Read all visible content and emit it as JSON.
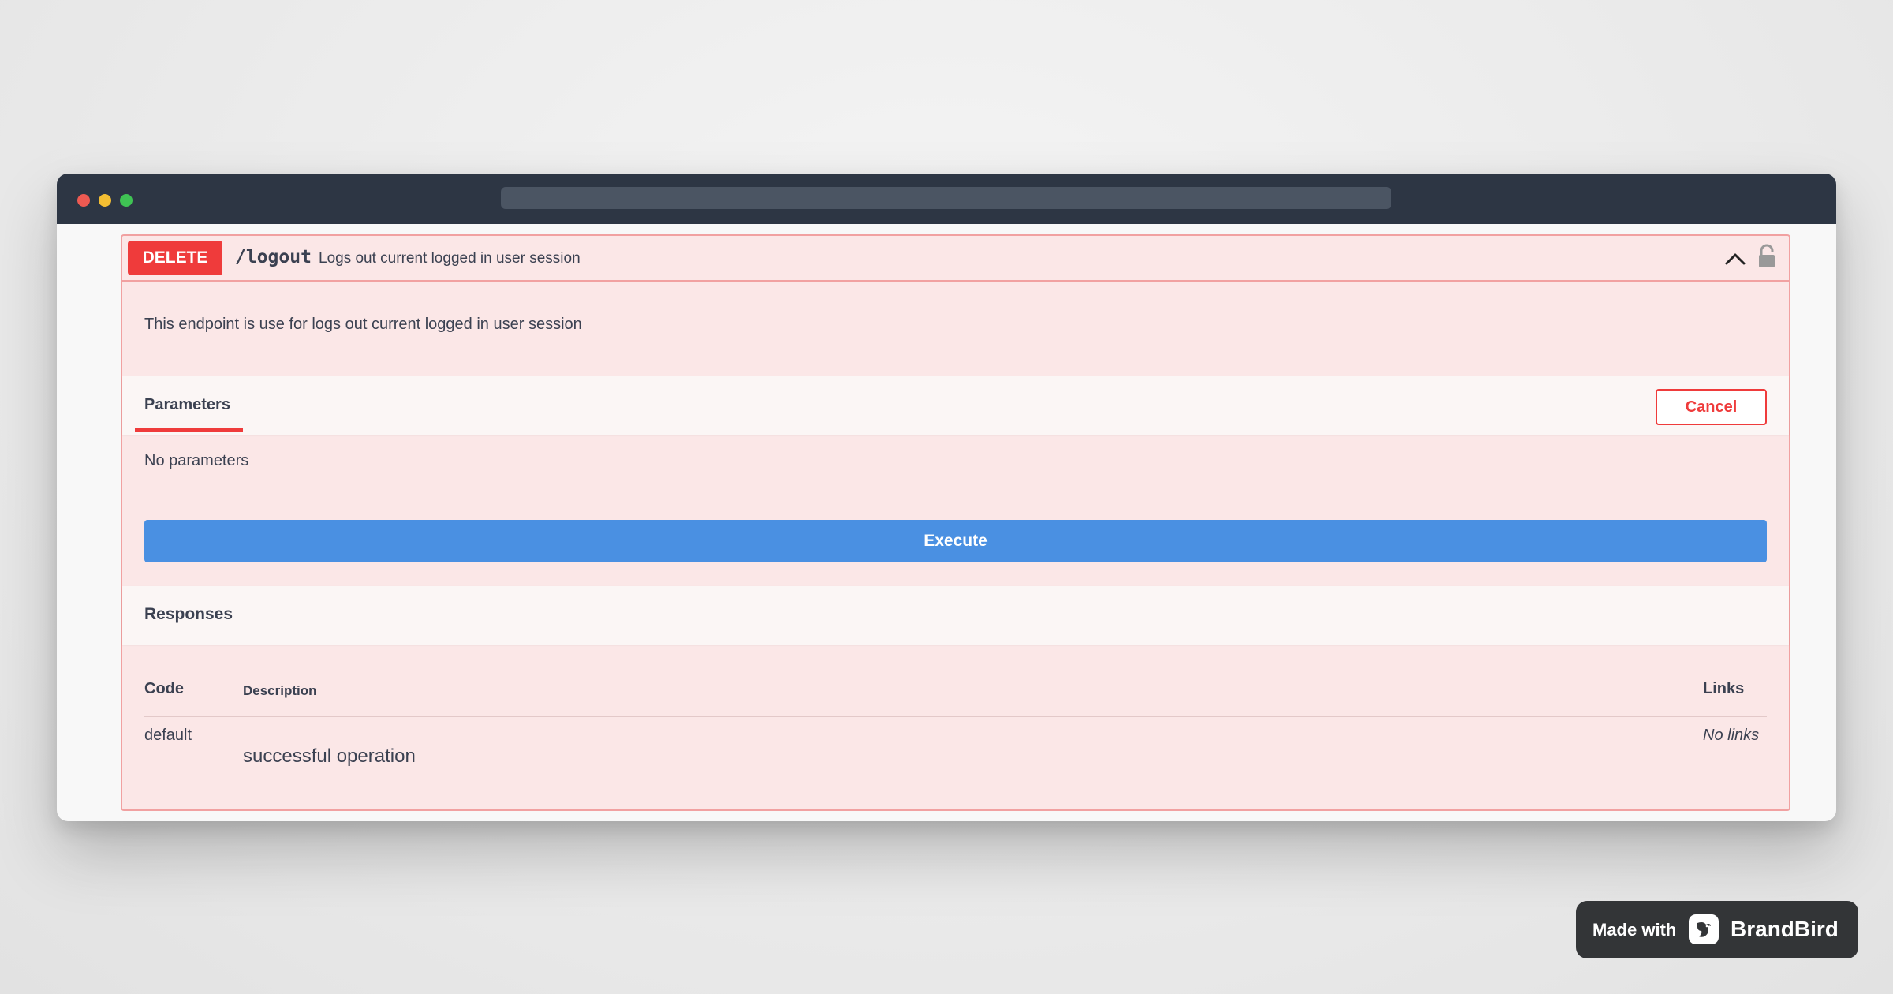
{
  "operation": {
    "method": "DELETE",
    "path": "/logout",
    "summary": "Logs out current logged in user session",
    "description": "This endpoint is use for logs out current logged in user session",
    "colors": {
      "method": "#ef3b3b",
      "background": "#fbe7e7",
      "border": "#f1a1a1"
    }
  },
  "parameters": {
    "tab_label": "Parameters",
    "cancel_label": "Cancel",
    "empty_text": "No parameters"
  },
  "execute": {
    "label": "Execute",
    "color": "#4a90e2"
  },
  "responses": {
    "title": "Responses",
    "columns": {
      "code": "Code",
      "description": "Description",
      "links": "Links"
    },
    "rows": [
      {
        "code": "default",
        "description": "successful operation",
        "links": "No links"
      }
    ]
  },
  "icons": {
    "collapse": "chevron-up-icon",
    "auth": "lock-icon"
  },
  "badge": {
    "made_with": "Made with",
    "brand": "BrandBird"
  }
}
